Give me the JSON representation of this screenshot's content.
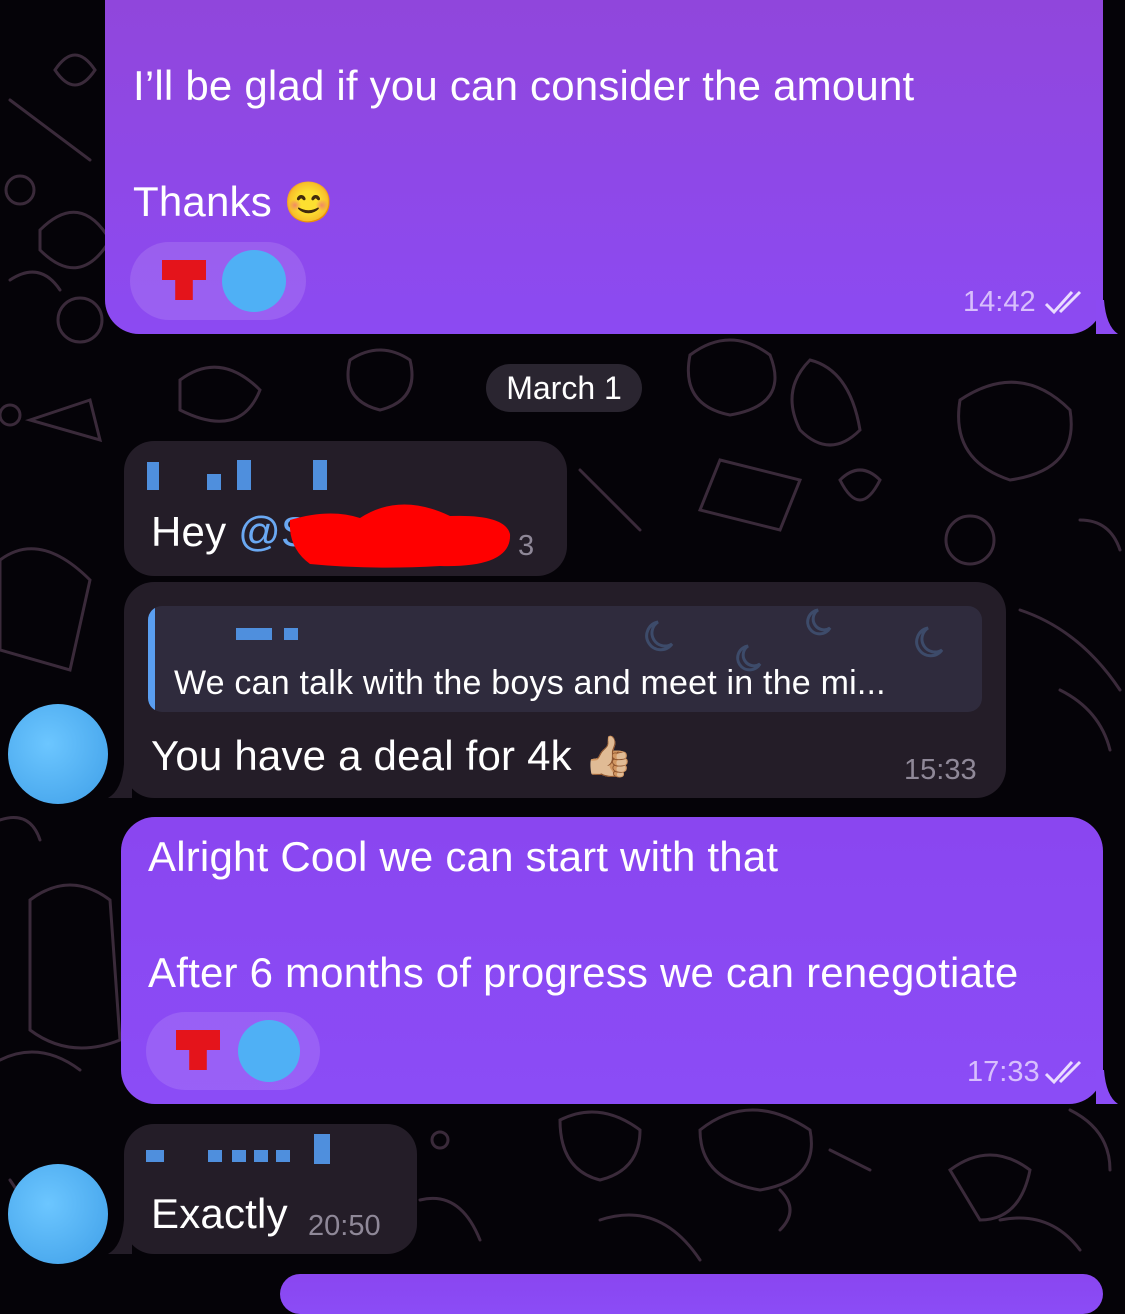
{
  "colors": {
    "outgoing_bubble": "#8c4af2",
    "incoming_bubble": "#241d28",
    "date_pill": "#2a2530",
    "link": "#6aa8f2",
    "redaction": "#ff0000",
    "reaction_heart": "#e4141b"
  },
  "messages": [
    {
      "direction": "outgoing",
      "line1": "I’ll be glad if you can consider the amount",
      "line2": "Thanks",
      "emoji": "😊",
      "time": "14:42",
      "status": "read-double-check",
      "reactions": [
        "heart",
        "avatar-blob"
      ]
    },
    {
      "direction": "date",
      "label": "March 1"
    },
    {
      "direction": "incoming",
      "text": "Hey",
      "mention": "@S",
      "time_partial": "3"
    },
    {
      "direction": "incoming",
      "quote": "We can talk with the boys and meet in the mi...",
      "text": "You have a deal for 4k",
      "emoji": "👍🏼",
      "time": "15:33"
    },
    {
      "direction": "outgoing",
      "line1": "Alright Cool we can start with that",
      "line2": "After 6 months of progress we can renegotiate",
      "time": "17:33",
      "status": "read-double-check",
      "reactions": [
        "heart",
        "avatar-blob"
      ]
    },
    {
      "direction": "incoming",
      "text": "Exactly",
      "time": "20:50"
    }
  ]
}
